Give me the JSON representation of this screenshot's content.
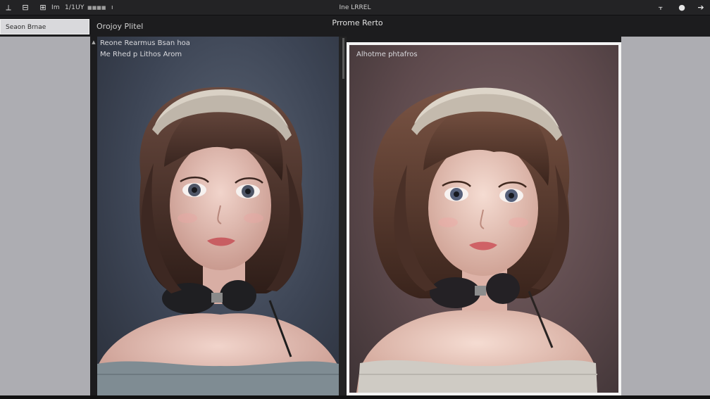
{
  "toolbar": {
    "icons": [
      {
        "name": "back-icon",
        "glyph": "⟂"
      },
      {
        "name": "grid-icon",
        "glyph": "⊟"
      },
      {
        "name": "layout-icon",
        "glyph": "⊞"
      }
    ],
    "label_1": "Im",
    "label_2": "1/1UY",
    "label_3": "■■■■",
    "label_4": "ı",
    "app_title": "Ine LRREL",
    "right_icons": [
      {
        "name": "pin-icon",
        "glyph": "⫟"
      },
      {
        "name": "circle-icon",
        "glyph": "●"
      },
      {
        "name": "arrow-icon",
        "glyph": "➔"
      }
    ]
  },
  "secondary_bar": {
    "side_tab": "Seaon Brnae",
    "breadcrumb": "Orojoy Plitel",
    "panel_title": "Prrome Rerto"
  },
  "panels": {
    "left": {
      "caption_line_1": "Reone Rearmus Bsan hoa",
      "caption_line_2": "Me Rhed p Lithos Arom"
    },
    "right": {
      "caption": "Alhotme phtafros"
    }
  },
  "colors": {
    "sidebar": "#adadb2",
    "left_bg": "#3d4555",
    "right_bg": "#5e4a4d",
    "frame": "#f4f4f4"
  }
}
